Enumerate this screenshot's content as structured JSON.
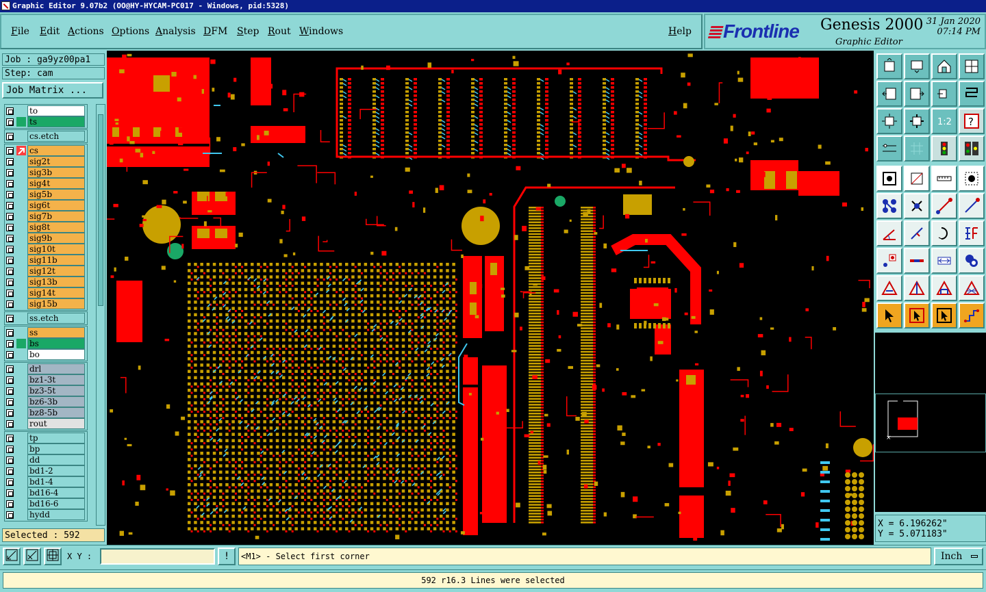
{
  "window": {
    "title": "Graphic Editor 9.07b2 (OO@HY-HYCAM-PC017 - Windows, pid:5328)"
  },
  "menu": {
    "file": "File",
    "edit": "Edit",
    "actions": "Actions",
    "options": "Options",
    "analysis": "Analysis",
    "dfm": "DFM",
    "step": "Step",
    "rout": "Rout",
    "windows": "Windows",
    "help": "Help"
  },
  "brand": {
    "logo": "Frontline",
    "product": "Genesis 2000",
    "subtitle": "Graphic Editor",
    "date": "31 Jan 2020",
    "time": "07:14 PM"
  },
  "job": {
    "job_label": "Job : ga9yz00pa1",
    "step_label": "Step: cam",
    "matrix_button": "Job Matrix ..."
  },
  "layers": [
    {
      "name": "to",
      "color": "#ffffff",
      "tag": "",
      "group": 0
    },
    {
      "name": "ts",
      "color": "#1aa866",
      "tag": "",
      "group": 0
    },
    {
      "name": "cs.etch",
      "color": "#8fd8d6",
      "tag": "",
      "group": 1
    },
    {
      "name": "cs",
      "color": "#f4b24a",
      "tag": "work",
      "group": 2
    },
    {
      "name": "sig2t",
      "color": "#f4b24a",
      "tag": "",
      "group": 2
    },
    {
      "name": "sig3b",
      "color": "#f4b24a",
      "tag": "",
      "group": 2
    },
    {
      "name": "sig4t",
      "color": "#f4b24a",
      "tag": "",
      "group": 2
    },
    {
      "name": "sig5b",
      "color": "#f4b24a",
      "tag": "",
      "group": 2
    },
    {
      "name": "sig6t",
      "color": "#f4b24a",
      "tag": "",
      "group": 2
    },
    {
      "name": "sig7b",
      "color": "#f4b24a",
      "tag": "",
      "group": 2
    },
    {
      "name": "sig8t",
      "color": "#f4b24a",
      "tag": "",
      "group": 2
    },
    {
      "name": "sig9b",
      "color": "#f4b24a",
      "tag": "",
      "group": 2
    },
    {
      "name": "sig10t",
      "color": "#f4b24a",
      "tag": "",
      "group": 2
    },
    {
      "name": "sig11b",
      "color": "#f4b24a",
      "tag": "",
      "group": 2
    },
    {
      "name": "sig12t",
      "color": "#f4b24a",
      "tag": "",
      "group": 2
    },
    {
      "name": "sig13b",
      "color": "#f4b24a",
      "tag": "",
      "group": 2
    },
    {
      "name": "sig14t",
      "color": "#f4b24a",
      "tag": "",
      "group": 2
    },
    {
      "name": "sig15b",
      "color": "#f4b24a",
      "tag": "",
      "group": 2
    },
    {
      "name": "ss.etch",
      "color": "#8fd8d6",
      "tag": "",
      "group": 3
    },
    {
      "name": "ss",
      "color": "#f4b24a",
      "tag": "",
      "group": 4
    },
    {
      "name": "bs",
      "color": "#1aa866",
      "tag": "",
      "group": 4
    },
    {
      "name": "bo",
      "color": "#ffffff",
      "tag": "",
      "group": 4
    },
    {
      "name": "drl",
      "color": "#a3b6c4",
      "tag": "",
      "group": 5
    },
    {
      "name": "bz1-3t",
      "color": "#a3b6c4",
      "tag": "",
      "group": 5
    },
    {
      "name": "bz3-5t",
      "color": "#a3b6c4",
      "tag": "",
      "group": 5
    },
    {
      "name": "bz6-3b",
      "color": "#a3b6c4",
      "tag": "",
      "group": 5
    },
    {
      "name": "bz8-5b",
      "color": "#a3b6c4",
      "tag": "",
      "group": 5
    },
    {
      "name": "rout",
      "color": "#e2e2e2",
      "tag": "",
      "group": 5
    },
    {
      "name": "tp",
      "color": "#8fd8d6",
      "tag": "",
      "group": 6
    },
    {
      "name": "bp",
      "color": "#8fd8d6",
      "tag": "",
      "group": 6
    },
    {
      "name": "dd",
      "color": "#8fd8d6",
      "tag": "",
      "group": 6
    },
    {
      "name": "bd1-2",
      "color": "#8fd8d6",
      "tag": "",
      "group": 6
    },
    {
      "name": "bd1-4",
      "color": "#8fd8d6",
      "tag": "",
      "group": 6
    },
    {
      "name": "bd16-4",
      "color": "#8fd8d6",
      "tag": "",
      "group": 6
    },
    {
      "name": "bd16-6",
      "color": "#8fd8d6",
      "tag": "",
      "group": 6
    },
    {
      "name": "hydd",
      "color": "#8fd8d6",
      "tag": "",
      "group": 6
    }
  ],
  "selection": {
    "label": "Selected : 592"
  },
  "coords": {
    "x": "X = 6.196262\"",
    "y": "Y = 5.071183\""
  },
  "bottom": {
    "xy_label": "X Y :",
    "xy_value": "",
    "prompt": "<M1> - Select first corner",
    "unit": "Inch"
  },
  "status": {
    "message": "592 r16.3 Lines were selected"
  },
  "colors": {
    "copper_pad": "#c8a000",
    "copper_fill": "#ff0000",
    "selected_line": "#40c8f0",
    "canvas_bg": "#000000",
    "panel_bg": "#8fd8d6"
  },
  "tools": [
    "zoom-home-icon",
    "zoom-fit-icon",
    "home-icon",
    "split-view-icon",
    "pan-left-icon",
    "pan-right-icon",
    "redraw-icon",
    "refresh-icon",
    "zoom-in-icon",
    "zoom-out-icon",
    "scale-1-2-icon",
    "help-icon",
    "measure-icon",
    "grid-icon",
    "traffic-light-icon",
    "traffic-light-alt-icon",
    "snap-center-icon",
    "snap-edge-icon",
    "ruler-icon",
    "snap-point-icon",
    "net-icon",
    "cross-icon",
    "add-line-icon",
    "add-arc-icon",
    "drag-line-icon",
    "slash-icon",
    "rotate-icon",
    "flip-icon",
    "add-pad-icon",
    "bar-icon",
    "resize-icon",
    "layers-icon",
    "triangle-icon",
    "triangle-split-icon",
    "triangle-a-icon",
    "triangle-x-icon",
    "pointer-icon",
    "pointer-box-icon",
    "pointer-select-icon",
    "route-icon"
  ]
}
